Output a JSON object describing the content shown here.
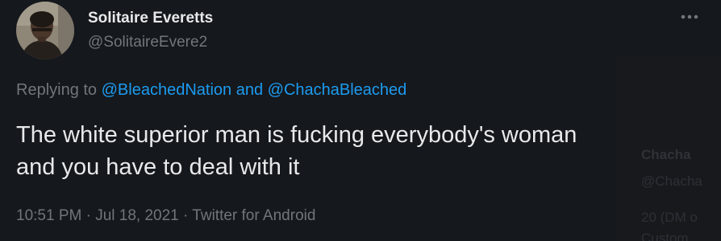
{
  "author": {
    "name": "Solitaire Everetts",
    "handle": "@SolitaireEvere2"
  },
  "more_icon": "more-horizontal-icon",
  "reply": {
    "prefix": "Replying to",
    "mention_1": "@BleachedNation",
    "conjunction": "and",
    "mention_2": "@ChachaBleached"
  },
  "tweet": {
    "line_1": "The white superior man is fucking everybody's woman",
    "line_2": "and you have to deal with it"
  },
  "meta": {
    "time": "10:51 PM",
    "sep_1": "·",
    "date": "Jul 18, 2021",
    "sep_2": "·",
    "source": "Twitter for Android"
  },
  "background_card": {
    "name": "Chacha",
    "handle": "@Chacha",
    "line_1": "20 (DM o",
    "line_2": "Custom"
  },
  "colors": {
    "background": "#15181c",
    "text_primary": "#e7e9ea",
    "text_secondary": "#71767b",
    "link": "#1d9bf0"
  }
}
